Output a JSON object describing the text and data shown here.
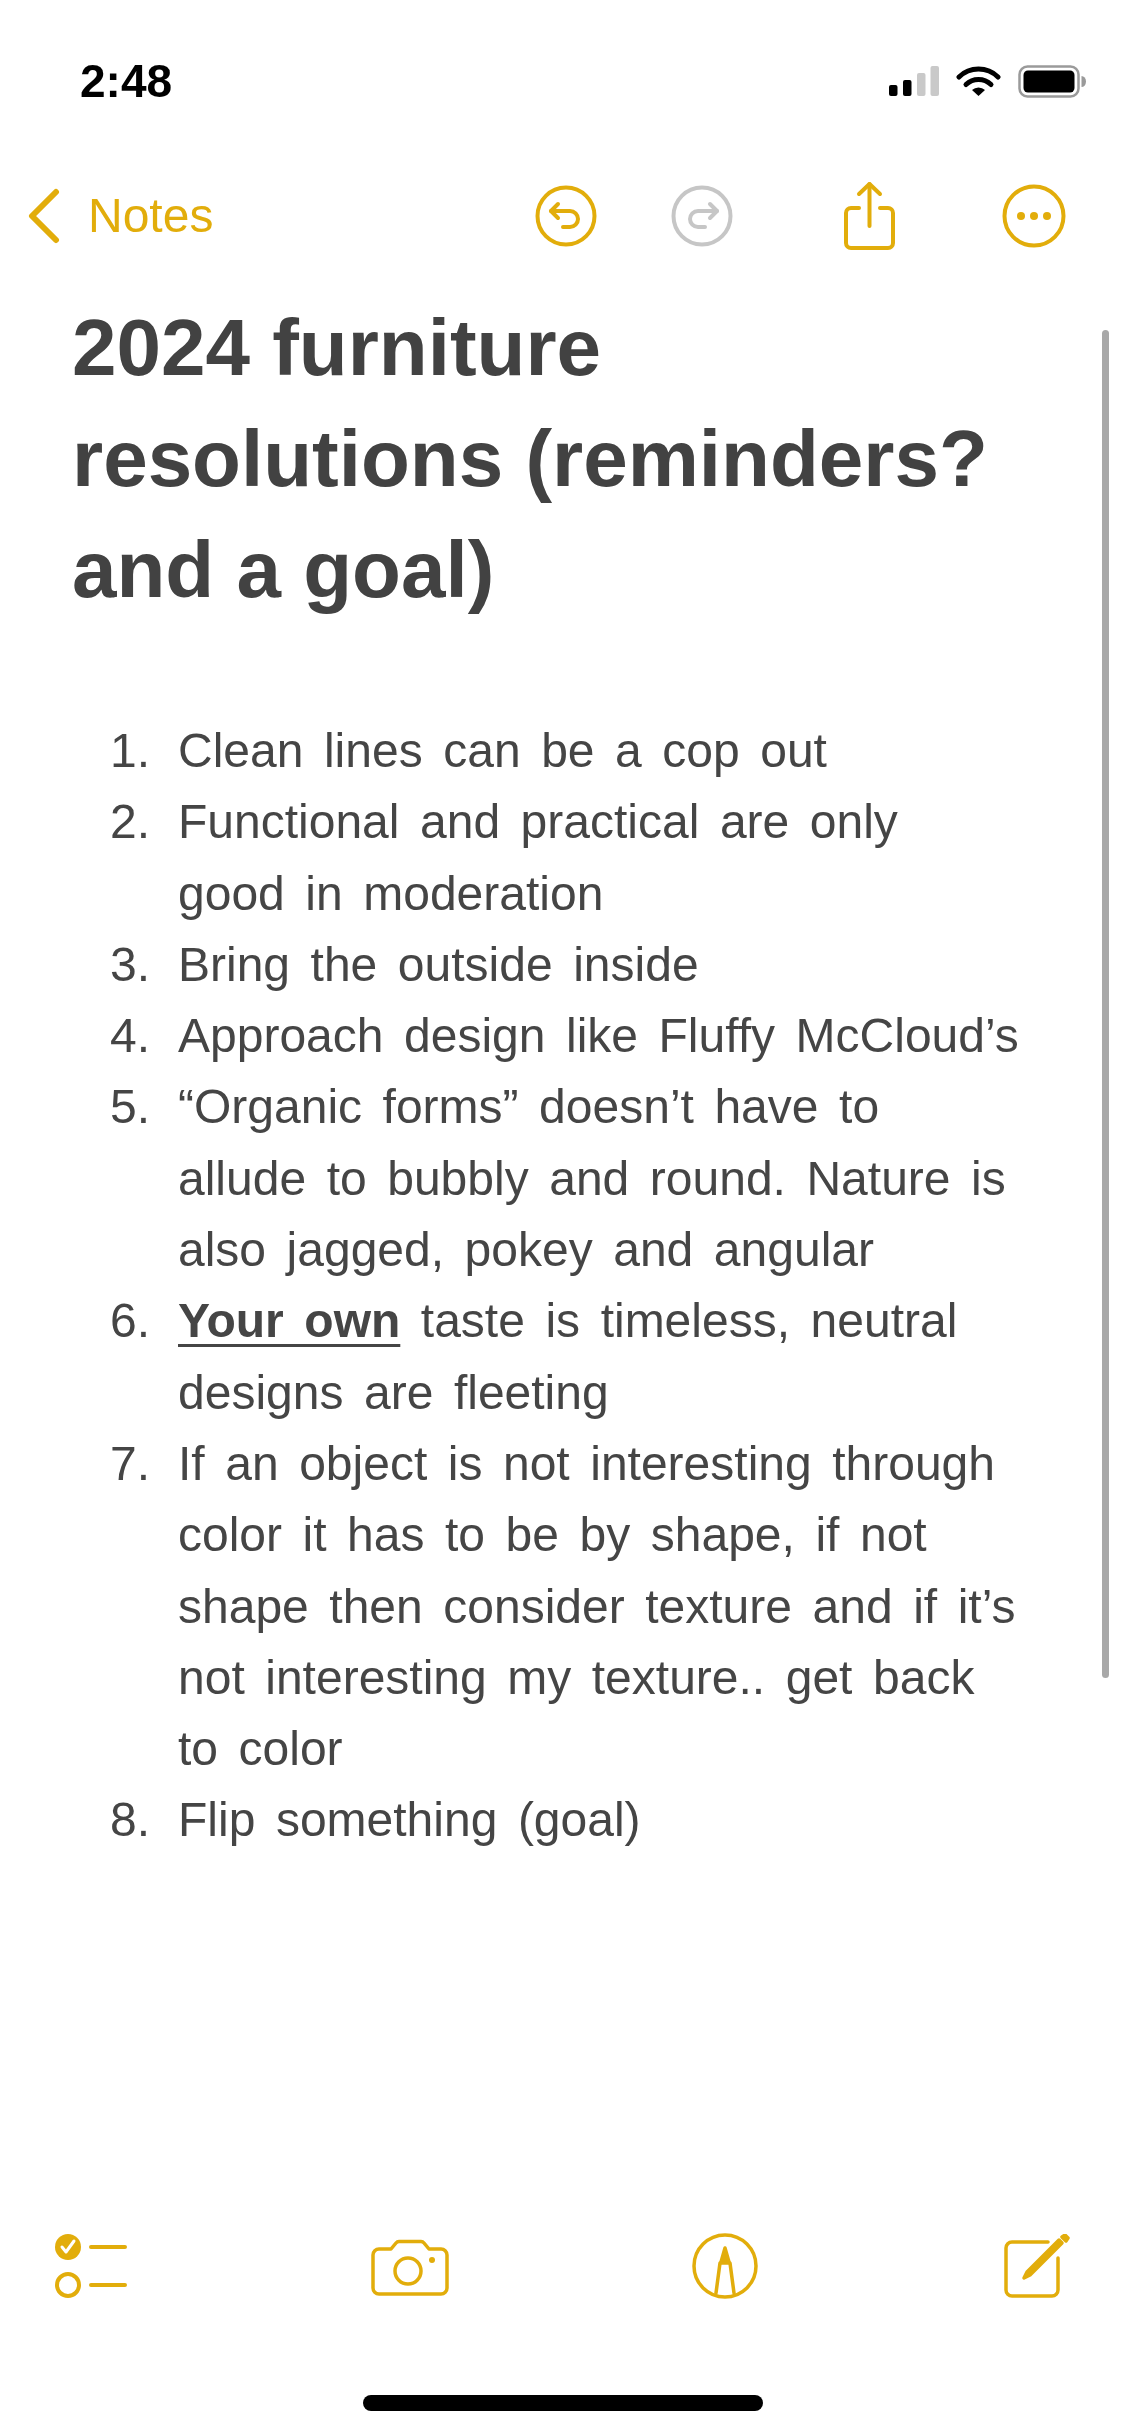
{
  "status_bar": {
    "time": "2:48"
  },
  "nav": {
    "back_label": "Notes",
    "undo": {
      "disabled": false
    },
    "redo": {
      "disabled": true
    }
  },
  "note": {
    "title": "2024 furniture resolutions (reminders? and a goal)",
    "items": [
      {
        "number": "1.",
        "text": "Clean lines can be a cop out"
      },
      {
        "number": "2.",
        "text": "Functional and practical are only good in moderation"
      },
      {
        "number": "3.",
        "text": "Bring the outside inside"
      },
      {
        "number": "4.",
        "text": "Approach design like Fluffy McCloud’s"
      },
      {
        "number": "5.",
        "text": "“Organic forms” doesn’t have to allude to bubbly and round. Nature is also jagged, pokey and angular"
      },
      {
        "number": "6.",
        "text": "**Your own** taste is timeless, neutral designs are fleeting"
      },
      {
        "number": "7.",
        "text": "If an object is not interesting through color it has to be by shape, if not shape then consider texture and if it’s not interesting my texture.. get back to color"
      },
      {
        "number": "8.",
        "text": "Flip something (goal)"
      }
    ]
  }
}
